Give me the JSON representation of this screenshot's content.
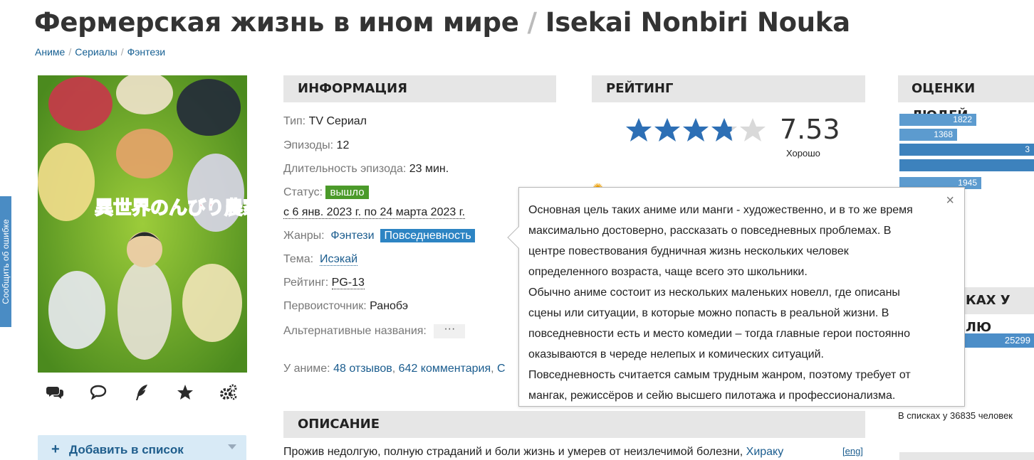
{
  "side_report": {
    "label": "Сообщить об ошибке"
  },
  "header": {
    "title_ru": "Фермерская жизнь в ином мире",
    "separator": "/",
    "title_en": "Isekai Nonbiri Nouka",
    "breadcrumbs": [
      "Аниме",
      "Сериалы",
      "Фэнтези"
    ],
    "crumb_sep": "/"
  },
  "poster": {
    "logo_text": "異世界のんびり農家"
  },
  "poster_icons": [
    "comments-icon",
    "comment-icon",
    "feather-icon",
    "star-icon",
    "gears-icon"
  ],
  "add_to_list": {
    "plus": "+",
    "label": "Добавить в список"
  },
  "info": {
    "heading": "ИНФОРМАЦИЯ",
    "type_label": "Тип:",
    "type_value": "TV Сериал",
    "episodes_label": "Эпизоды:",
    "episodes_value": "12",
    "duration_label": "Длительность эпизода:",
    "duration_value": "23 мин.",
    "status_label": "Статус:",
    "status_value": "вышло",
    "dates": "с 6 янв. 2023 г. по 24 марта 2023 г.",
    "genres_label": "Жанры:",
    "genre_1": "Фэнтези",
    "genre_2": "Повседневность",
    "theme_label": "Тема:",
    "theme_value": "Исэкай",
    "rating_label": "Рейтинг:",
    "rating_value": "PG-13",
    "source_label": "Первоисточник:",
    "source_value": "Ранобэ",
    "alt_label": "Альтернативные названия:",
    "alt_button": "···",
    "stats_label": "У аниме:",
    "reviews": "48 отзывов",
    "comments": "642 комментария",
    "stats_cut": "С"
  },
  "rating": {
    "heading": "РЕЙТИНГ",
    "score": "7.53",
    "score_fraction": 0.753,
    "word": "Хорошо"
  },
  "people": {
    "heading": "ОЦЕНКИ ЛЮДЕЙ",
    "bars": [
      "1822",
      "1368",
      "3",
      "",
      "1945"
    ],
    "bar_fractions": [
      0.57,
      0.43,
      1.0,
      1.0,
      0.61
    ]
  },
  "lists": {
    "heading_fragment": "КАХ У ЛЮ",
    "bar_value": "25299",
    "caption": "В списках у 36835 человек"
  },
  "tooltip": {
    "close": "×",
    "lines": [
      "Основная цель таких аниме или манги - художественно, и в то же время",
      "максимально достоверно, рассказать о повседневных проблемах. В",
      "центре повествования будничная жизнь нескольких человек",
      "определенного возраста, чаще всего это школьники.",
      "Обычно аниме состоит из нескольких маленьких новелл, где описаны",
      "сцены или ситуации, в которые можно попасть в реальной жизни. В",
      "повседневности есть и место комедии – тогда главные герои постоянно",
      "оказываются в череде нелепых и комических ситуаций.",
      "Повседневность считается самым трудным жанром, поэтому требует от",
      "мангак, режиссёров и сейю высшего пилотажа и профессионализма."
    ]
  },
  "description": {
    "heading": "ОПИСАНИЕ",
    "text": "Прожив недолгую, полную страданий и боли жизнь и умерев от неизлечимой болезни,",
    "name_link": "Хираку",
    "eng_link": "[eng]"
  }
}
